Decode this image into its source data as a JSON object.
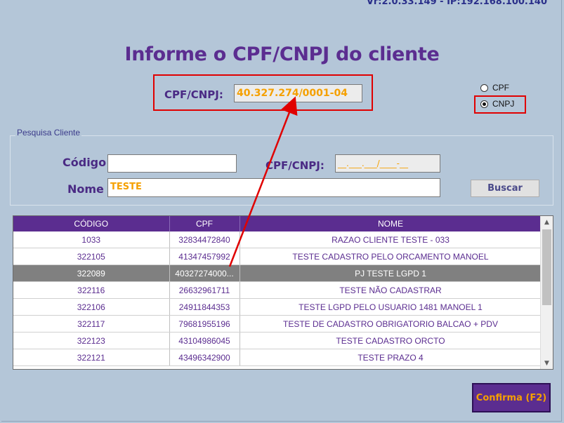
{
  "version": "Vr:2.0.33.149 - IP:192.168.100.140",
  "title": "Informe o CPF/CNPJ do cliente",
  "doc_input": {
    "label": "CPF/CNPJ:",
    "value": "40.327.274/0001-04"
  },
  "doc_type": {
    "options": [
      "CPF",
      "CNPJ"
    ],
    "selected": "CNPJ"
  },
  "search": {
    "group_title": "Pesquisa Cliente",
    "codigo_label": "Código",
    "codigo_value": "",
    "cpfcnpj_label": "CPF/CNPJ:",
    "cpfcnpj_mask": "__.___.___/____-__",
    "nome_label": "Nome",
    "nome_value": "TESTE",
    "buscar_label": "Buscar"
  },
  "grid": {
    "columns": [
      "CÓDIGO",
      "CPF",
      "NOME"
    ],
    "rows": [
      [
        "1033",
        "32834472840",
        "RAZAO CLIENTE TESTE - 033"
      ],
      [
        "322105",
        "41347457992",
        "TESTE CADASTRO PELO ORCAMENTO MANOEL"
      ],
      [
        "322089",
        "40327274000...",
        "PJ TESTE LGPD 1"
      ],
      [
        "322116",
        "26632961711",
        "TESTE NÃO CADASTRAR"
      ],
      [
        "322106",
        "24911844353",
        "TESTE LGPD PELO USUARIO 1481 MANOEL 1"
      ],
      [
        "322117",
        "79681955196",
        "TESTE DE CADASTRO OBRIGATORIO BALCAO + PDV"
      ],
      [
        "322123",
        "43104986045",
        "TESTE CADASTRO ORCTO"
      ],
      [
        "322121",
        "43496342900",
        "TESTE PRAZO 4"
      ]
    ],
    "selected_row": 2
  },
  "confirm_label": "Confirma (F2)",
  "colors": {
    "purple": "#5b2d90",
    "orange": "#f5a000",
    "highlight": "#e00000"
  }
}
